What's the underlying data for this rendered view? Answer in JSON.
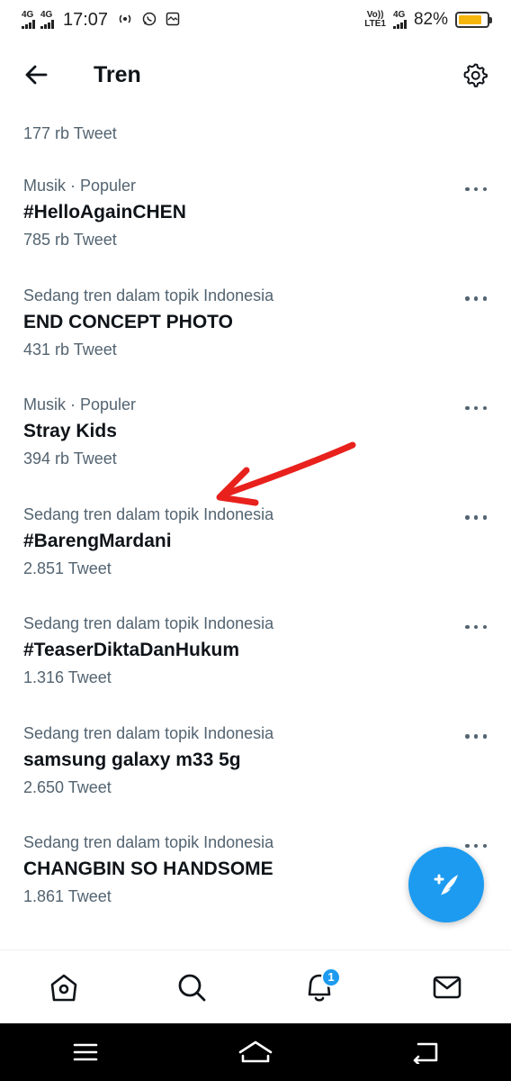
{
  "status_bar": {
    "net1": "4G",
    "net2": "4G",
    "time": "17:07",
    "volte_line1": "Vo))",
    "volte_line2": "LTE1",
    "net3": "4G",
    "battery_percent": "82%",
    "battery_level": 0.82,
    "battery_color": "#f7b60e"
  },
  "header": {
    "title": "Tren",
    "back_icon": "arrow-left-icon",
    "settings_icon": "gear-icon"
  },
  "partial_item": {
    "count": "177 rb Tweet"
  },
  "trends": [
    {
      "context": "Musik · Populer",
      "name": "#HelloAgainCHEN",
      "count": "785 rb Tweet"
    },
    {
      "context": "Sedang tren dalam topik Indonesia",
      "name": "END CONCEPT PHOTO",
      "count": "431 rb Tweet"
    },
    {
      "context": "Musik · Populer",
      "name": "Stray Kids",
      "count": "394 rb Tweet"
    },
    {
      "context": "Sedang tren dalam topik Indonesia",
      "name": "#BarengMardani",
      "count": "2.851 Tweet"
    },
    {
      "context": "Sedang tren dalam topik Indonesia",
      "name": "#TeaserDiktaDanHukum",
      "count": "1.316 Tweet"
    },
    {
      "context": "Sedang tren dalam topik Indonesia",
      "name": "samsung galaxy m33 5g",
      "count": "2.650 Tweet"
    },
    {
      "context": "Sedang tren dalam topik Indonesia",
      "name": "CHANGBIN SO HANDSOME",
      "count": "1.861 Tweet"
    }
  ],
  "fab": {
    "icon": "compose-tweet-icon",
    "color": "#1d9bf0"
  },
  "bottom_nav": {
    "items": [
      "home-icon",
      "search-icon",
      "notifications-icon",
      "messages-icon"
    ],
    "notification_count": "1"
  },
  "colors": {
    "accent": "#1d9bf0",
    "text_primary": "#0f1419",
    "text_secondary": "#536471",
    "annotation_arrow": "#e8211d"
  }
}
